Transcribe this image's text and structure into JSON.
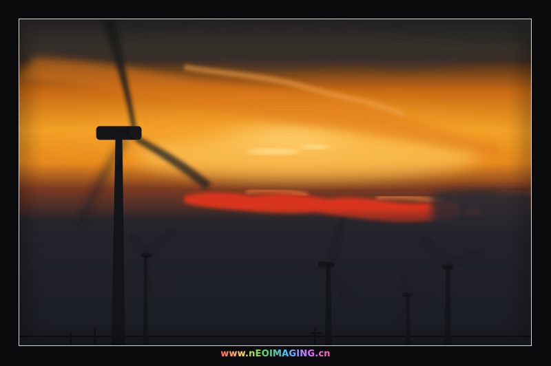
{
  "photo": {
    "subject": "wind-turbines-at-sunset",
    "colors": {
      "sky_dark": "#1d2027",
      "glow_orange": "#f39a1e",
      "glow_red": "#d8361a",
      "glow_yellow": "#ffd060",
      "silhouette": "#131418",
      "border": "#d9d9d9"
    }
  },
  "watermark": {
    "text": "www.nEOIMAGING.cn"
  }
}
